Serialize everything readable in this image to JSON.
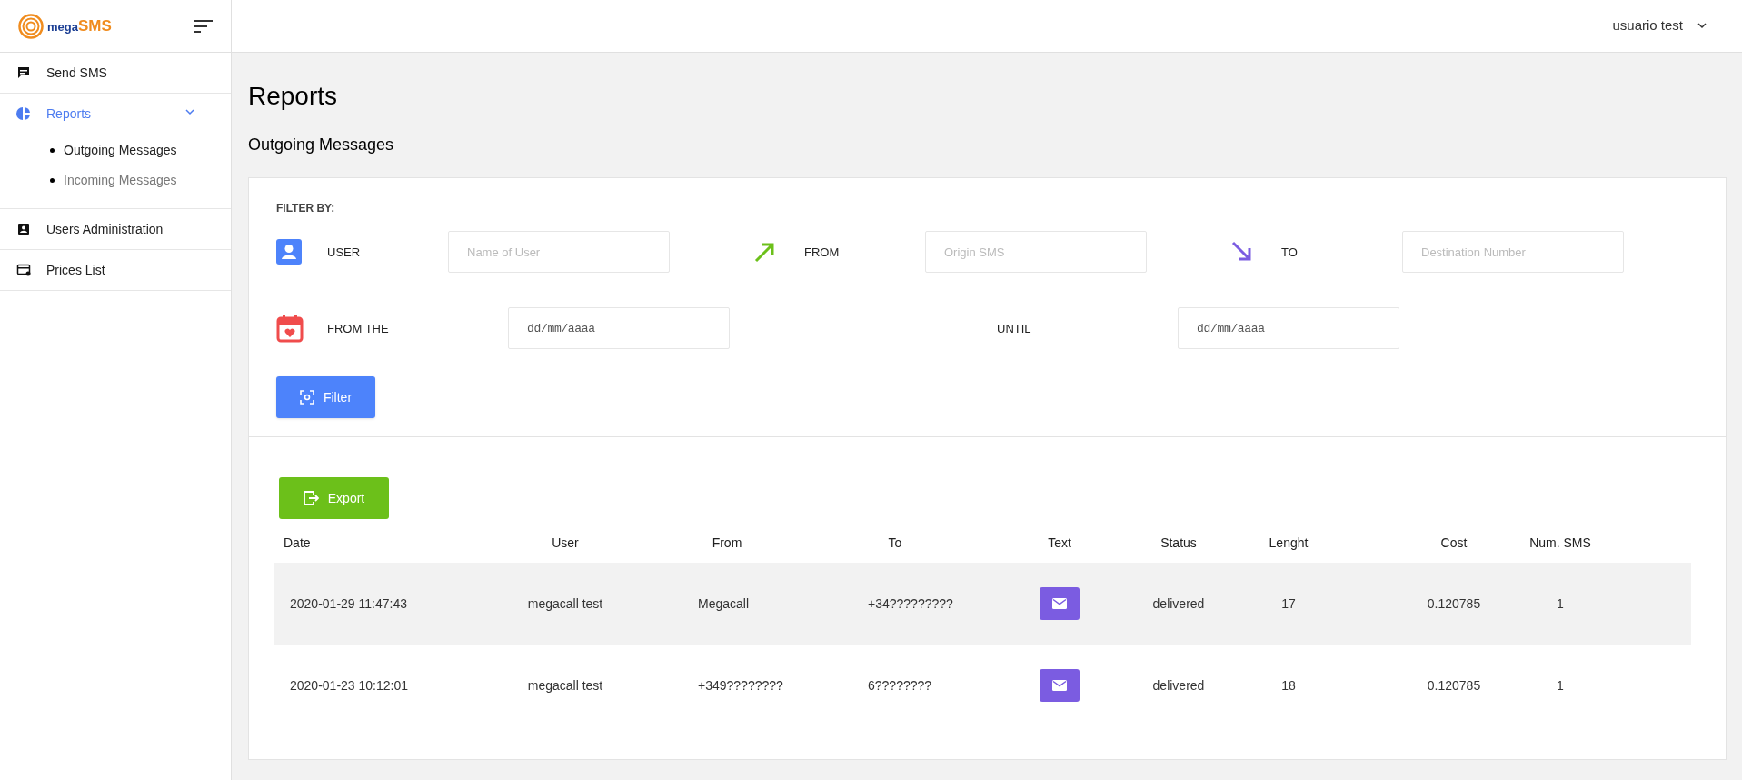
{
  "logo": {
    "first": "mega",
    "second": "SMS"
  },
  "user_menu": {
    "label": "usuario test"
  },
  "sidebar": {
    "items": [
      {
        "label": "Send SMS",
        "selected": false
      },
      {
        "label": "Reports",
        "selected": true,
        "expanded": true,
        "children": [
          {
            "label": "Outgoing Messages",
            "selected": true
          },
          {
            "label": "Incoming Messages",
            "selected": false
          }
        ]
      },
      {
        "label": "Users Administration",
        "selected": false
      },
      {
        "label": "Prices List",
        "selected": false
      }
    ]
  },
  "page_title": "Reports",
  "subtitle": "Outgoing Messages",
  "filter": {
    "heading": "FILTER BY:",
    "fields": [
      {
        "kind": "text",
        "label": "USER",
        "placeholder": "Name of User"
      },
      {
        "kind": "text",
        "label": "FROM",
        "placeholder": "Origin SMS"
      },
      {
        "kind": "text",
        "label": "TO",
        "placeholder": "Destination Number"
      },
      {
        "kind": "date",
        "label": "FROM THE",
        "placeholder": "dd/mm/aaaa"
      },
      {
        "kind": "date",
        "label": "UNTIL",
        "placeholder": "dd/mm/aaaa"
      }
    ],
    "button": "Filter"
  },
  "export_button": "Export",
  "table": {
    "columns": [
      "Date",
      "User",
      "From",
      "To",
      "Text",
      "Status",
      "Lenght",
      "Cost",
      "Num. SMS"
    ],
    "rows": [
      {
        "cells": [
          "2020-01-29 11:47:43",
          "megacall test",
          "Megacall",
          "+34?????????",
          "",
          "delivered",
          "17",
          "0.120785",
          "1"
        ]
      },
      {
        "cells": [
          "2020-01-23 10:12:01",
          "megacall test",
          "+349????????",
          "6????????",
          "",
          "delivered",
          "18",
          "0.120785",
          "1"
        ]
      }
    ]
  }
}
